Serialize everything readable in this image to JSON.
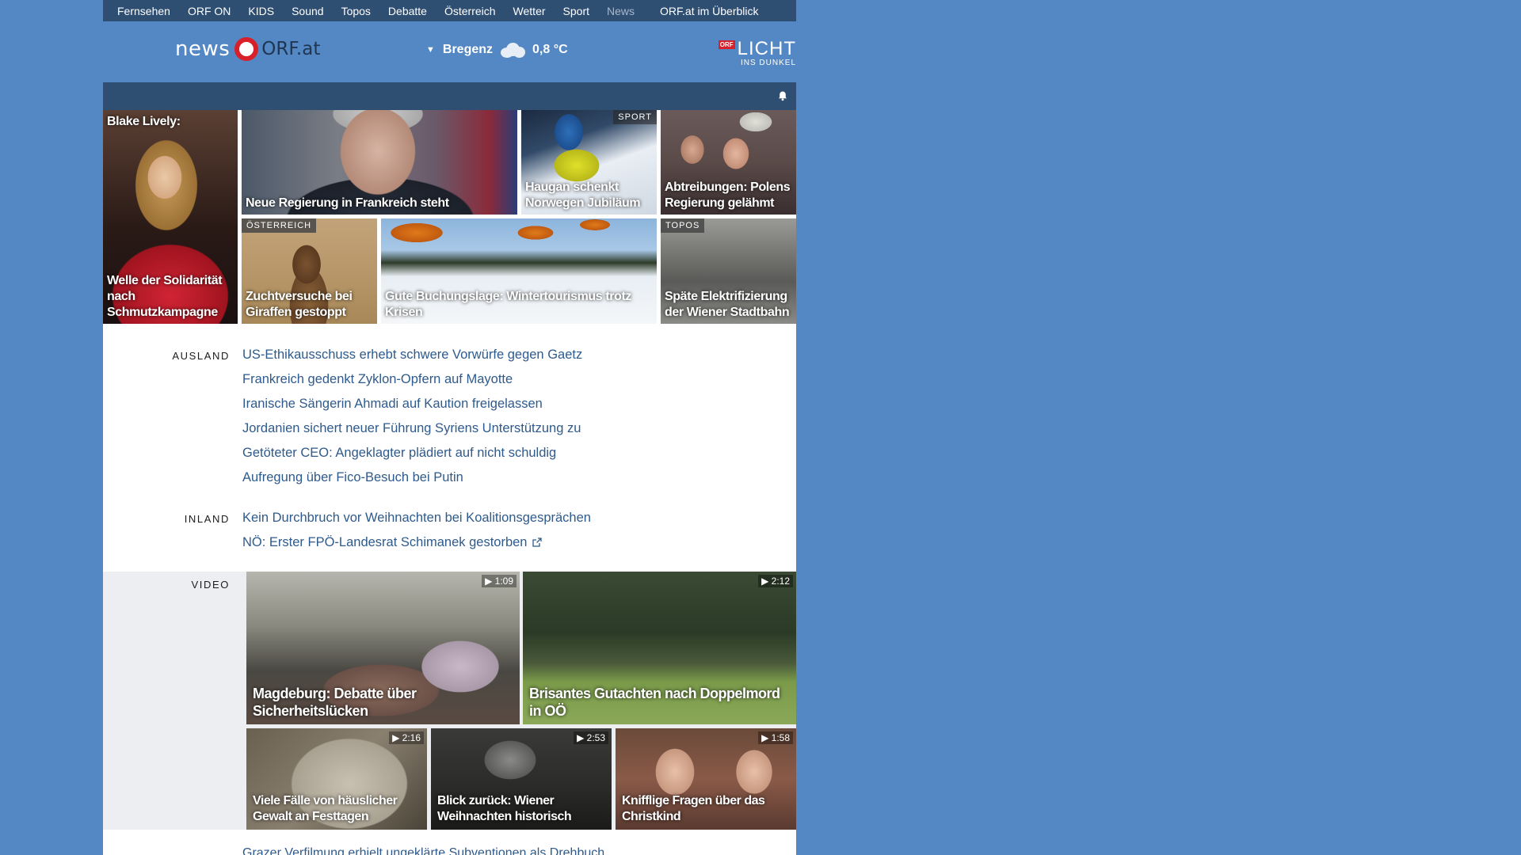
{
  "nav": {
    "items": [
      "Fernsehen",
      "ORF ON",
      "KIDS",
      "Sound",
      "Topos",
      "Debatte",
      "Österreich",
      "Wetter",
      "Sport",
      "News"
    ],
    "overview": "ORF.at im Überblick"
  },
  "header": {
    "logo_news": "news",
    "logo_orf": "ORF.at",
    "location": "Bregenz",
    "temperature": "0,8 °C",
    "licht_badge": "ORF",
    "licht_title": "LICHT",
    "licht_sub": "INS DUNKEL"
  },
  "tiles": {
    "t1_top": "Blake Lively:",
    "t1_caption": "Welle der Solidarität nach Schmutzkampagne",
    "t2_caption": "Neue Regierung in Frankreich steht",
    "t3_tag": "SPORT",
    "t3_caption": "Haugan schenkt Norwegen Jubiläum",
    "t4_caption": "Abtreibungen: Polens Regierung gelähmt",
    "t5_tag": "ÖSTERREICH",
    "t5_caption": "Zuchtversuche bei Giraffen gestoppt",
    "t6_caption": "Gute Buchungslage: Wintertourismus trotz Krisen",
    "t7_tag": "TOPOS",
    "t7_caption": "Späte Elektrifizierung der Wiener Stadtbahn"
  },
  "ausland": {
    "label": "AUSLAND",
    "links": [
      "US-Ethikausschuss erhebt schwere Vorwürfe gegen Gaetz",
      "Frankreich gedenkt Zyklon-Opfern auf Mayotte",
      "Iranische Sängerin Ahmadi auf Kaution freigelassen",
      "Jordanien sichert neuer Führung Syriens Unterstützung zu",
      "Getöteter CEO: Angeklagter plädiert auf nicht schuldig",
      "Aufregung über Fico-Besuch bei Putin"
    ]
  },
  "inland": {
    "label": "INLAND",
    "links": [
      "Kein Durchbruch vor Weihnachten bei Koalitionsgesprächen",
      "NÖ: Erster FPÖ-Landesrat Schimanek gestorben"
    ]
  },
  "video": {
    "label": "VIDEO",
    "items": [
      {
        "duration": "▶ 1:09",
        "title": "Magdeburg: Debatte über Sicherheitslücken"
      },
      {
        "duration": "▶ 2:12",
        "title": "Brisantes Gutachten nach Doppelmord in OÖ"
      },
      {
        "duration": "▶ 2:16",
        "title": "Viele Fälle von häuslicher Gewalt an Festtagen"
      },
      {
        "duration": "▶ 2:53",
        "title": "Blick zurück: Wiener Weihnachten historisch"
      },
      {
        "duration": "▶ 1:58",
        "title": "Knifflige Fragen über das Christkind"
      }
    ]
  },
  "next_line": "Grazer Verfilmung erhielt ungeklärte Subventionen als Drehbuch",
  "colors": {
    "page_bg": "#5488c4",
    "nav_bg": "#2e4e72",
    "link": "#2e5a8c",
    "orf_red": "#d8202a"
  }
}
